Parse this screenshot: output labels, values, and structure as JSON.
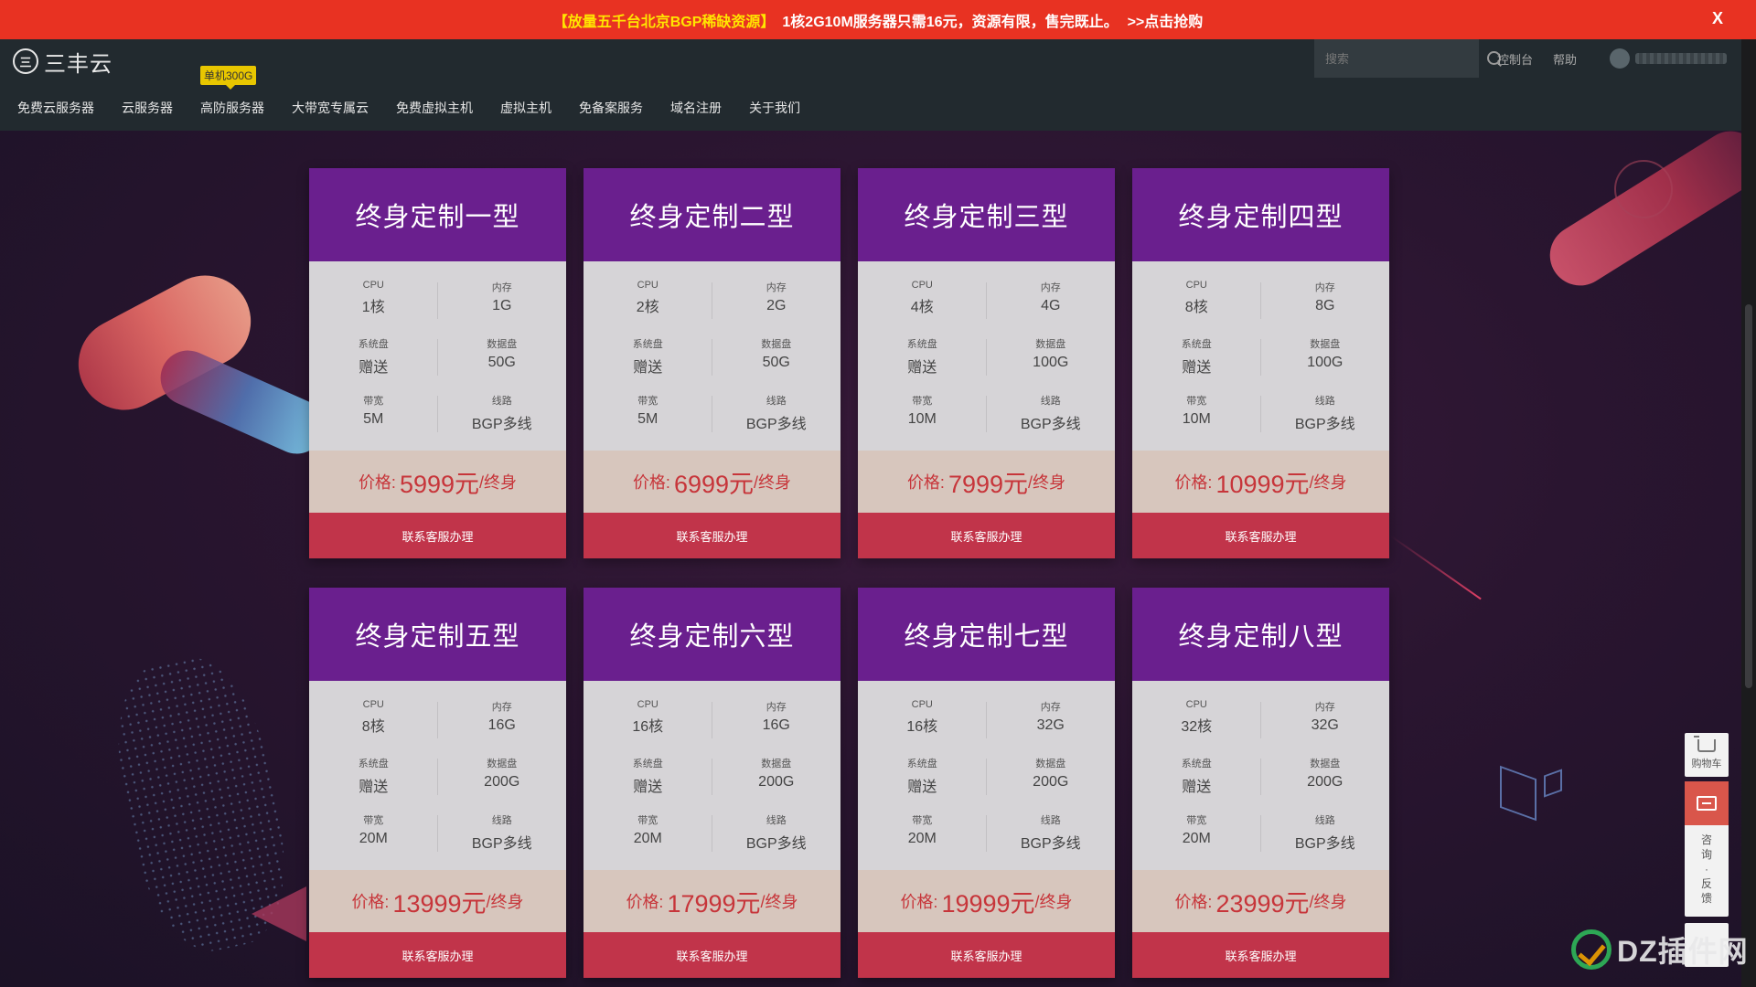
{
  "promo": {
    "highlight": "【放量五千台北京BGP稀缺资源】",
    "text": "1核2G10M服务器只需16元，资源有限，售完既止。",
    "link": ">>点击抢购",
    "close": "X"
  },
  "header": {
    "logo_mark": "三",
    "logo_name": "三丰云",
    "search_placeholder": "搜索",
    "console": "控制台",
    "help": "帮助",
    "nav_badge": "单机300G",
    "nav": [
      "免费云服务器",
      "云服务器",
      "高防服务器",
      "大带宽专属云",
      "免费虚拟主机",
      "虚拟主机",
      "免备案服务",
      "域名注册",
      "关于我们"
    ]
  },
  "labels": {
    "cpu": "CPU",
    "mem": "内存",
    "sys_disk": "系统盘",
    "data_disk": "数据盘",
    "bandwidth": "带宽",
    "line": "线路",
    "price_prefix": "价格:",
    "price_unit": "/终身",
    "button": "联系客服办理"
  },
  "products": [
    {
      "title": "终身定制一型",
      "cpu": "1核",
      "mem": "1G",
      "sys": "赠送",
      "data": "50G",
      "bw": "5M",
      "line": "BGP多线",
      "price": "5999元"
    },
    {
      "title": "终身定制二型",
      "cpu": "2核",
      "mem": "2G",
      "sys": "赠送",
      "data": "50G",
      "bw": "5M",
      "line": "BGP多线",
      "price": "6999元"
    },
    {
      "title": "终身定制三型",
      "cpu": "4核",
      "mem": "4G",
      "sys": "赠送",
      "data": "100G",
      "bw": "10M",
      "line": "BGP多线",
      "price": "7999元"
    },
    {
      "title": "终身定制四型",
      "cpu": "8核",
      "mem": "8G",
      "sys": "赠送",
      "data": "100G",
      "bw": "10M",
      "line": "BGP多线",
      "price": "10999元"
    },
    {
      "title": "终身定制五型",
      "cpu": "8核",
      "mem": "16G",
      "sys": "赠送",
      "data": "200G",
      "bw": "20M",
      "line": "BGP多线",
      "price": "13999元"
    },
    {
      "title": "终身定制六型",
      "cpu": "16核",
      "mem": "16G",
      "sys": "赠送",
      "data": "200G",
      "bw": "20M",
      "line": "BGP多线",
      "price": "17999元"
    },
    {
      "title": "终身定制七型",
      "cpu": "16核",
      "mem": "32G",
      "sys": "赠送",
      "data": "200G",
      "bw": "20M",
      "line": "BGP多线",
      "price": "19999元"
    },
    {
      "title": "终身定制八型",
      "cpu": "32核",
      "mem": "32G",
      "sys": "赠送",
      "data": "200G",
      "bw": "20M",
      "line": "BGP多线",
      "price": "23999元"
    }
  ],
  "side": {
    "cart": "购物车",
    "consult": "咨询·反馈"
  },
  "watermark": "DZ插件网",
  "colors": {
    "promo_bg": "#e83222",
    "promo_highlight": "#ffe500",
    "card_head": "#6a1f8e",
    "price_text": "#c7353a",
    "button_bg": "#c1344a"
  }
}
